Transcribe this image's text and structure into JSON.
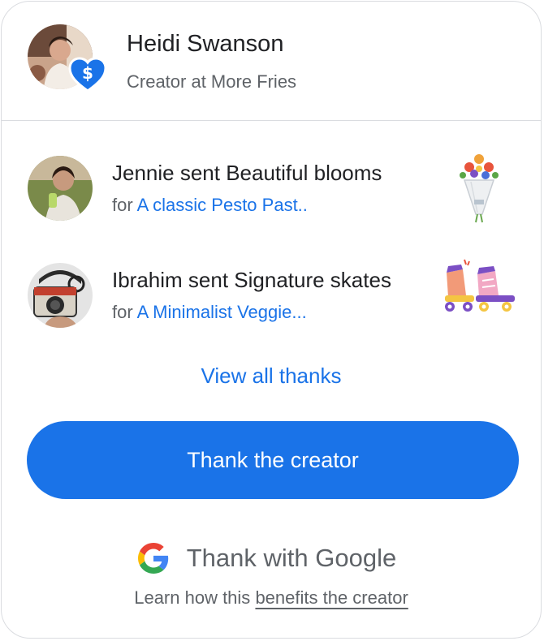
{
  "header": {
    "creator_name": "Heidi Swanson",
    "creator_role": "Creator at More Fries",
    "badge_icon": "dollar-heart-icon"
  },
  "thanks": [
    {
      "title": "Jennie sent Beautiful blooms",
      "for_label": "for",
      "post_title": "A classic Pesto Past..",
      "gift_icon": "flower-bouquet-icon"
    },
    {
      "title": "Ibrahim sent Signature skates",
      "for_label": "for",
      "post_title": "A Minimalist Veggie...",
      "gift_icon": "roller-skates-icon"
    }
  ],
  "view_all_label": "View all thanks",
  "thank_button_label": "Thank the creator",
  "brand": {
    "text": "Thank with Google",
    "logo_icon": "google-g-icon"
  },
  "learn": {
    "prefix": "Learn how this",
    "link_text": "benefits the creator"
  },
  "colors": {
    "accent": "#1a73e8",
    "text_primary": "#202124",
    "text_secondary": "#5f6368",
    "divider": "#dadce0"
  }
}
